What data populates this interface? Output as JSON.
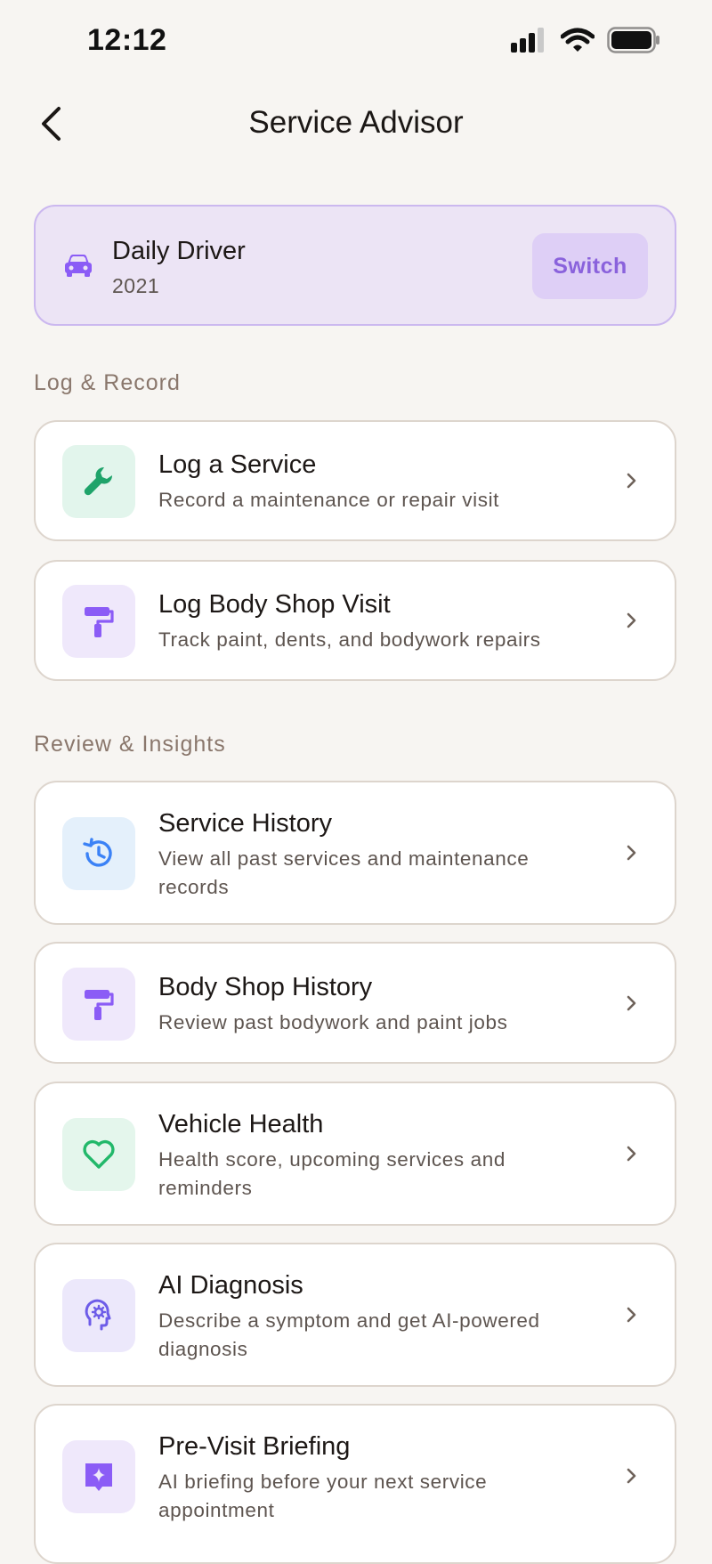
{
  "status": {
    "time": "12:12"
  },
  "nav": {
    "title": "Service Advisor"
  },
  "vehicle": {
    "name": "Daily Driver",
    "year": "2021",
    "switch_label": "Switch"
  },
  "sections": {
    "log": "Log & Record",
    "review": "Review & Insights"
  },
  "items": [
    {
      "title": "Log a Service",
      "subtitle": "Record a maintenance or repair visit",
      "icon": "wrench-icon",
      "accent": "#1fa36a"
    },
    {
      "title": "Log Body Shop Visit",
      "subtitle": "Track paint, dents, and bodywork repairs",
      "icon": "paint-roller-icon",
      "accent": "#8b5cf6"
    },
    {
      "title": "Service History",
      "subtitle": "View all past services and maintenance records",
      "icon": "history-icon",
      "accent": "#3b82f6"
    },
    {
      "title": "Body Shop History",
      "subtitle": "Review past bodywork and paint jobs",
      "icon": "paint-roller-icon",
      "accent": "#8b5cf6"
    },
    {
      "title": "Vehicle Health",
      "subtitle": "Health score, upcoming services and reminders",
      "icon": "heart-icon",
      "accent": "#22b86a"
    },
    {
      "title": "AI Diagnosis",
      "subtitle": "Describe a symptom and get AI-powered diagnosis",
      "icon": "ai-brain-icon",
      "accent": "#6d5ce8"
    },
    {
      "title": "Pre-Visit Briefing",
      "subtitle": "AI briefing before your next service appointment",
      "icon": "sparkle-icon",
      "accent": "#8b5cf6"
    }
  ]
}
